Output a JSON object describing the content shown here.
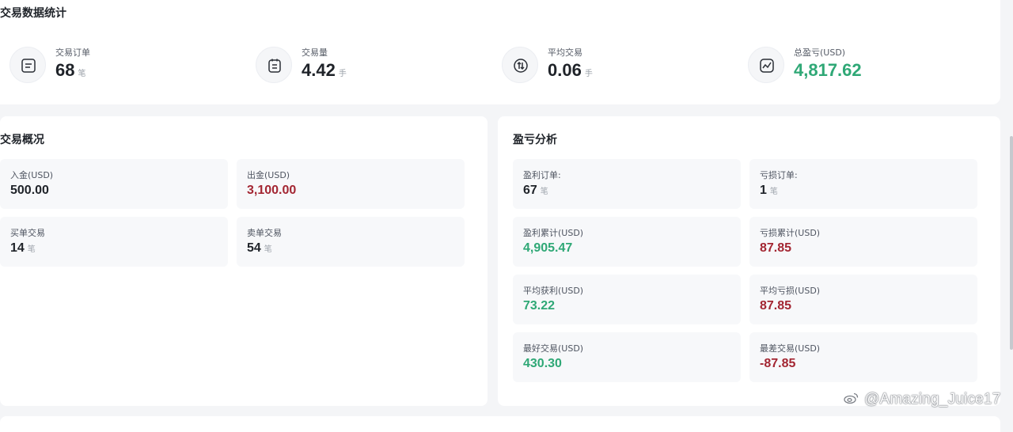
{
  "summary": {
    "title": "交易数据统计",
    "stats": [
      {
        "label": "交易订单",
        "value": "68",
        "unit": "笔",
        "icon": "order-list-icon"
      },
      {
        "label": "交易量",
        "value": "4.42",
        "unit": "手",
        "icon": "volume-clipboard-icon"
      },
      {
        "label": "平均交易",
        "value": "0.06",
        "unit": "手",
        "icon": "average-arrows-icon"
      },
      {
        "label": "总盈亏(USD)",
        "value": "4,817.62",
        "unit": "",
        "icon": "trend-line-icon"
      }
    ]
  },
  "overview": {
    "title": "交易概况",
    "tiles": [
      {
        "label": "入金(USD)",
        "value": "500.00",
        "unit": ""
      },
      {
        "label": "出金(USD)",
        "value": "3,100.00",
        "unit": ""
      },
      {
        "label": "买单交易",
        "value": "14",
        "unit": "笔"
      },
      {
        "label": "卖单交易",
        "value": "54",
        "unit": "笔"
      }
    ]
  },
  "pnl": {
    "title": "盈亏分析",
    "tiles": [
      {
        "label": "盈利订单:",
        "value": "67",
        "unit": "笔"
      },
      {
        "label": "亏损订单:",
        "value": "1",
        "unit": "笔"
      },
      {
        "label": "盈利累计(USD)",
        "value": "4,905.47",
        "unit": ""
      },
      {
        "label": "亏损累计(USD)",
        "value": "87.85",
        "unit": ""
      },
      {
        "label": "平均获利(USD)",
        "value": "73.22",
        "unit": ""
      },
      {
        "label": "平均亏损(USD)",
        "value": "87.85",
        "unit": ""
      },
      {
        "label": "最好交易(USD)",
        "value": "430.30",
        "unit": ""
      },
      {
        "label": "最差交易(USD)",
        "value": "-87.85",
        "unit": ""
      }
    ]
  },
  "watermark": "@Amazing_Juice17",
  "colors": {
    "profit": "#2fa876",
    "loss": "#a32632",
    "tile_bg": "#f7f8fa",
    "page_bg": "#f4f5f7"
  }
}
